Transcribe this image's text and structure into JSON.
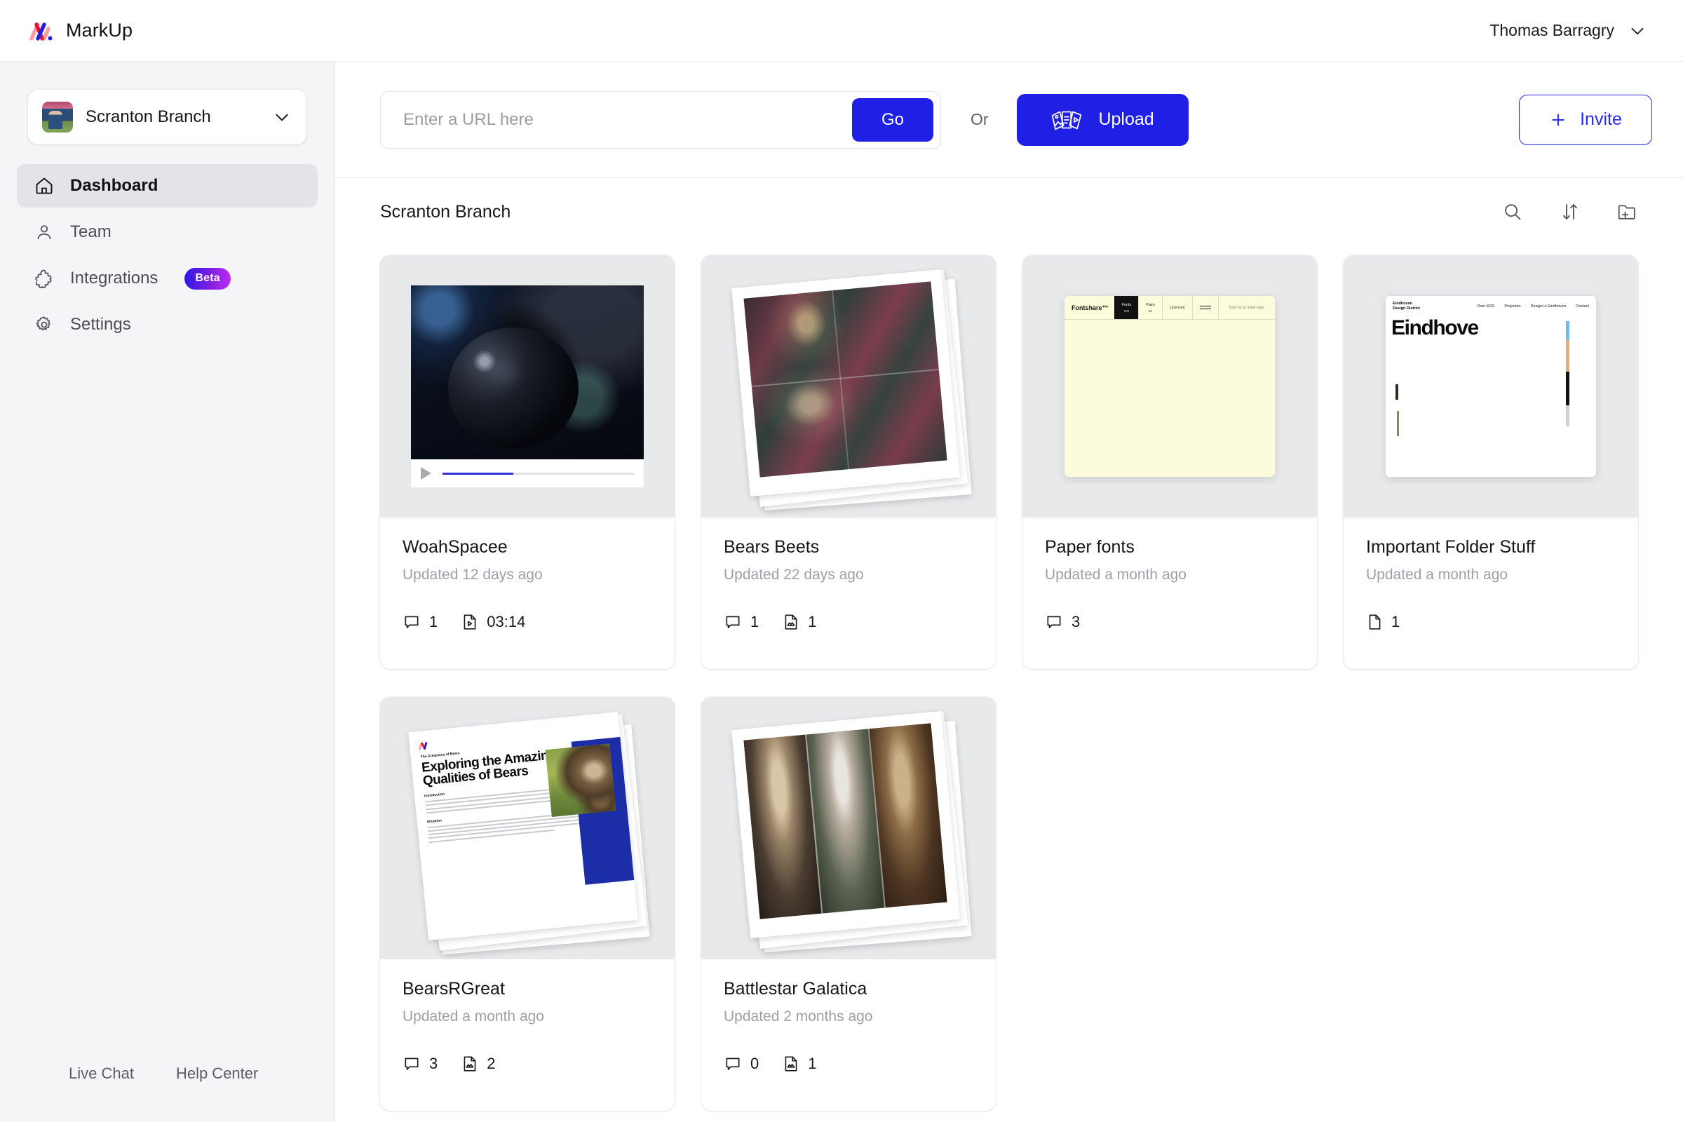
{
  "app": {
    "brand_name": "MarkUp",
    "logo_icon": "markup-logo-icon"
  },
  "topbar": {
    "user_name": "Thomas Barragry",
    "user_chevron_icon": "chevron-down-icon"
  },
  "sidebar": {
    "workspace": {
      "name": "Scranton Branch",
      "chevron_icon": "chevron-down-icon",
      "avatar_icon": "workspace-thumbnail"
    },
    "items": [
      {
        "label": "Dashboard",
        "icon": "home-icon",
        "active": true,
        "badge": null
      },
      {
        "label": "Team",
        "icon": "user-icon",
        "active": false,
        "badge": null
      },
      {
        "label": "Integrations",
        "icon": "puzzle-icon",
        "active": false,
        "badge": "Beta"
      },
      {
        "label": "Settings",
        "icon": "gear-icon",
        "active": false,
        "badge": null
      }
    ],
    "footer_links": [
      {
        "label": "Live Chat"
      },
      {
        "label": "Help Center"
      }
    ]
  },
  "action_bar": {
    "url_placeholder": "Enter a URL here",
    "url_value": "",
    "go_label": "Go",
    "or_label": "Or",
    "upload_label": "Upload",
    "upload_icon": "media-cards-icon",
    "invite_label": "Invite",
    "invite_icon": "plus-icon"
  },
  "section": {
    "title": "Scranton Branch",
    "tools": [
      {
        "name": "search-icon"
      },
      {
        "name": "sort-icon"
      },
      {
        "name": "new-folder-icon"
      }
    ]
  },
  "cards": [
    {
      "title": "WoahSpacee",
      "updated": "Updated 12 days ago",
      "thumb_type": "video",
      "video_progress_percent": 37,
      "meta": [
        {
          "icon": "comment-icon",
          "value": "1"
        },
        {
          "icon": "video-file-icon",
          "value": "03:14"
        }
      ]
    },
    {
      "title": "Bears Beets",
      "updated": "Updated 22 days ago",
      "thumb_type": "polaroid-bears-dinner",
      "meta": [
        {
          "icon": "comment-icon",
          "value": "1"
        },
        {
          "icon": "image-file-icon",
          "value": "1"
        }
      ]
    },
    {
      "title": "Paper fonts",
      "updated": "Updated a month ago",
      "thumb_type": "site-fontshare",
      "site": {
        "brand": "Fontshare™",
        "nav": [
          {
            "label": "Fonts",
            "sub": "100",
            "dark": true
          },
          {
            "label": "Pairs",
            "sub": "50",
            "dark": false
          },
          {
            "label": "Licences",
            "sub": "",
            "dark": false
          }
        ],
        "menu_icon": "hamburger-icon",
        "note": "fonts by an indian type"
      },
      "meta": [
        {
          "icon": "comment-icon",
          "value": "3"
        }
      ]
    },
    {
      "title": "Important Folder Stuff",
      "updated": "Updated a month ago",
      "thumb_type": "site-eindhoven",
      "site": {
        "logo_line1": "Eindhoven",
        "logo_line2": "Design District",
        "nav": [
          "Over EDD",
          "Projecten",
          "Design in Eindhoven",
          "Contact"
        ],
        "heading": "Eindhove"
      },
      "meta": [
        {
          "icon": "file-icon",
          "value": "1"
        }
      ]
    },
    {
      "title": "BearsRGreat",
      "updated": "Updated a month ago",
      "thumb_type": "document-stack",
      "document": {
        "eyebrow": "The Greatness of Bears",
        "title": "Exploring the Amazing Qualities of Bears",
        "section1": "Introduction",
        "section2": "Situation"
      },
      "meta": [
        {
          "icon": "comment-icon",
          "value": "3"
        },
        {
          "icon": "image-file-icon",
          "value": "2"
        }
      ]
    },
    {
      "title": "Battlestar Galatica",
      "updated": "Updated 2 months ago",
      "thumb_type": "polaroid-bear-trio",
      "meta": [
        {
          "icon": "comment-icon",
          "value": "0"
        },
        {
          "icon": "image-file-icon",
          "value": "1"
        }
      ]
    }
  ],
  "colors": {
    "accent_blue": "#1f1fe6",
    "sidebar_bg": "#f4f5f7",
    "active_nav_bg": "#e3e4e7",
    "muted_text": "#9ea0a8",
    "badge_gradient_start": "#2b16e8",
    "badge_gradient_end": "#c02ef0"
  }
}
